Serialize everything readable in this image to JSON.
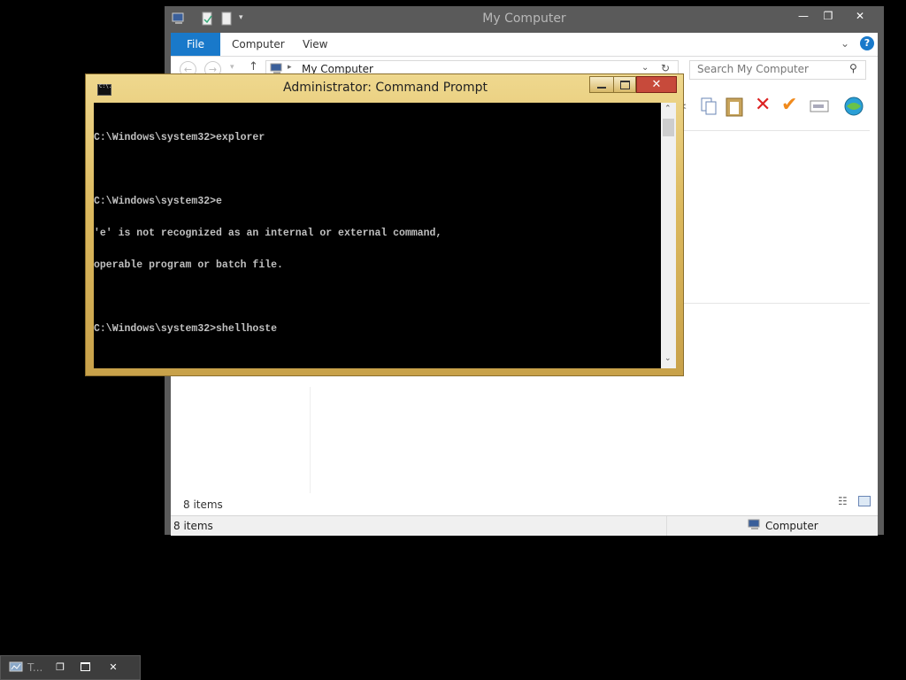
{
  "explorer": {
    "title": "My Computer",
    "tabs": {
      "file": "File",
      "computer": "Computer",
      "view": "View"
    },
    "address": "My Computer",
    "search_placeholder": "Search My Computer",
    "inner_status": "8 items",
    "status_items": "8 items",
    "status_zone": "Computer"
  },
  "cmd": {
    "title": "Administrator:  Command Prompt",
    "sys_icon_text": "C:\\.",
    "lines": [
      "C:\\Windows\\system32>explorer",
      "",
      "C:\\Windows\\system32>e",
      "'e' is not recognized as an internal or external command,",
      "operable program or batch file.",
      "",
      "C:\\Windows\\system32>shellhoste"
    ]
  },
  "taskbar": {
    "minimized_label": "T..."
  },
  "colors": {
    "ribbon_file_tab": "#1979ca",
    "cmd_frame": "#dcb95e",
    "close_button": "#c74a3b"
  }
}
